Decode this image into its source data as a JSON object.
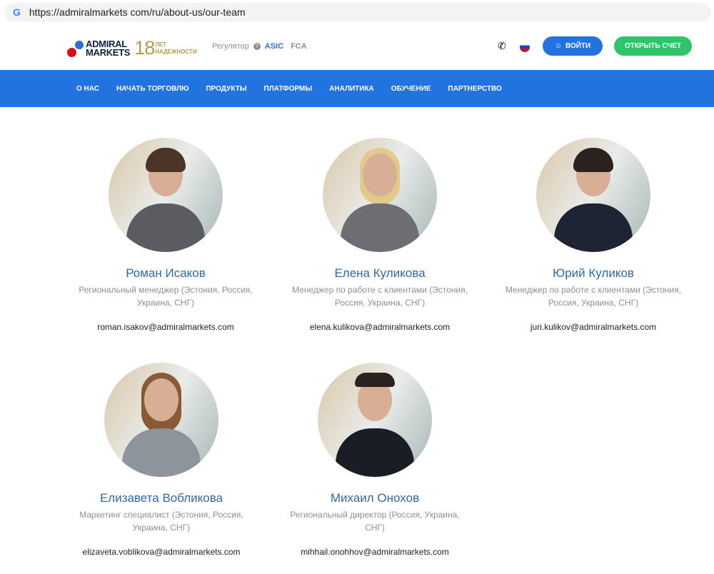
{
  "browser": {
    "url": "https://admiralmarkets com/ru/about-us/our-team"
  },
  "header": {
    "brand_line1": "ADMIRAL",
    "brand_line2": "MARKETS",
    "years": "18",
    "years_text1": "ЛЕТ",
    "years_text2": "НАДЕЖНОСТИ",
    "regulator_label": "Регулятор",
    "regulator_asic": "ASIC",
    "regulator_fca": "FCA",
    "login_label": "ВОЙТИ",
    "open_account_label": "ОТКРЫТЬ СЧЕТ"
  },
  "nav": [
    "О НАС",
    "НАЧАТЬ ТОРГОВЛЮ",
    "ПРОДУКТЫ",
    "ПЛАТФОРМЫ",
    "АНАЛИТИКА",
    "ОБУЧЕНИЕ",
    "ПАРТНЕРСТВО"
  ],
  "team": [
    {
      "name": "Роман Исаков",
      "role": "Региональный менеджер (Эстония, Россия, Украина, СНГ)",
      "email": "roman.isakov@admiralmarkets.com"
    },
    {
      "name": "Елена Куликова",
      "role": "Менеджер по работе с клиентами (Эстония, Россия, Украина, СНГ)",
      "email": "elena.kulikova@admiralmarkets.com"
    },
    {
      "name": "Юрий Куликов",
      "role": "Менеджер по работе с клиентами (Эстония, Россия, Украина, СНГ)",
      "email": "juri.kulikov@admiralmarkets.com"
    },
    {
      "name": "Елизавета Вобликова",
      "role": "Маркетинг специалист (Эстония, Россия, Украина, СНГ)",
      "email": "elizaveta.voblikova@admiralmarkets.com"
    },
    {
      "name": "Михаил Онохов",
      "role": "Региональный директор (Россия, Украина, СНГ)",
      "email": "mihhail.onohhov@admiralmarkets.com"
    }
  ]
}
